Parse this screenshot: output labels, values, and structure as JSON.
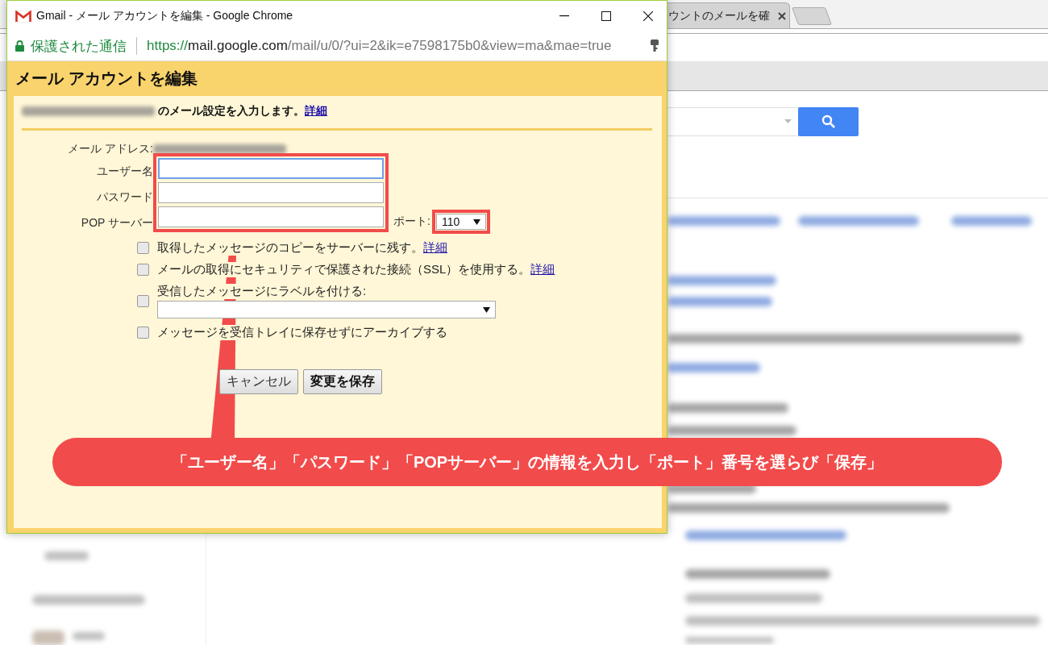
{
  "browser_tab": {
    "title": "ウントのメールを確"
  },
  "popup": {
    "title": "Gmail - メール アカウントを編集 - Google Chrome",
    "security_label": "保護された通信",
    "url": {
      "scheme": "https://",
      "host": "mail.google.com",
      "path": "/mail/u/0/?ui=2&ik=e7598175b0&view=ma&mae=true"
    }
  },
  "dialog": {
    "heading": "メール アカウントを編集",
    "intro": "のメール設定を入力します。",
    "intro_link": "詳細",
    "email_label": "メール アドレス:",
    "fields": [
      {
        "label": "ユーザー名",
        "focused": true
      },
      {
        "label": "パスワード",
        "focused": false
      },
      {
        "label": "POP サーバー",
        "focused": false
      }
    ],
    "port": {
      "label": "ポート:",
      "value": "110"
    },
    "options": [
      {
        "kind": "checkbox",
        "label": "取得したメッセージのコピーをサーバーに残す。",
        "link": "詳細",
        "checked": false
      },
      {
        "kind": "checkbox",
        "label": "メールの取得にセキュリティで保護された接続（SSL）を使用する。",
        "link": "詳細",
        "checked": false
      },
      {
        "kind": "label_select",
        "label": "受信したメッセージにラベルを付ける:",
        "checked": false
      },
      {
        "kind": "checkbox",
        "label": "メッセージを受信トレイに保存せずにアーカイブする",
        "checked": false
      }
    ],
    "buttons": [
      {
        "label": "キャンセル",
        "primary": false
      },
      {
        "label": "変更を保存",
        "primary": true
      }
    ]
  },
  "callout": {
    "text": "「ユーザー名」「パスワード」「POPサーバー」の情報を入力し「ポート」番号を選らび「保存」"
  }
}
